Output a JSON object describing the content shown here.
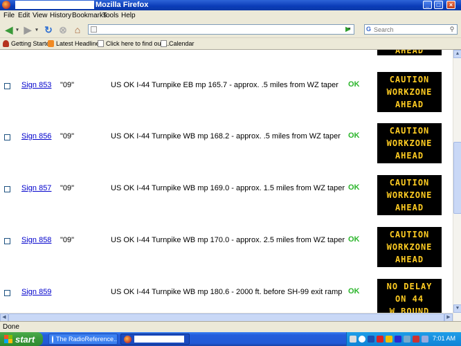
{
  "window": {
    "title": "Mozilla Firefox"
  },
  "menu": [
    "File",
    "Edit",
    "View",
    "History",
    "Bookmarks",
    "Tools",
    "Help"
  ],
  "search": {
    "placeholder": "Search"
  },
  "bookmarks": [
    "Getting Started",
    "Latest Headlines",
    "Click here to find out ...",
    "Calendar"
  ],
  "top_sign_partial": "AHEAD",
  "rows": [
    {
      "sign": "Sign 853",
      "code": "\"09\"",
      "location": "US OK I-44 Turnpike EB mp 165.7 - approx. .5 miles from WZ taper",
      "status": "OK",
      "message": [
        "CAUTION",
        "WORKZONE",
        "AHEAD"
      ]
    },
    {
      "sign": "Sign 856",
      "code": "\"09\"",
      "location": "US OK I-44 Turnpike WB mp 168.2 - approx. .5 miles from WZ taper",
      "status": "OK",
      "message": [
        "CAUTION",
        "WORKZONE",
        "AHEAD"
      ]
    },
    {
      "sign": "Sign 857",
      "code": "\"09\"",
      "location": "US OK I-44 Turnpike WB mp 169.0 - approx. 1.5 miles from WZ taper",
      "status": "OK",
      "message": [
        "CAUTION",
        "WORKZONE",
        "AHEAD"
      ]
    },
    {
      "sign": "Sign 858",
      "code": "\"09\"",
      "location": "US OK I-44 Turnpike WB mp 170.0 - approx. 2.5 miles from WZ taper",
      "status": "OK",
      "message": [
        "CAUTION",
        "WORKZONE",
        "AHEAD"
      ]
    },
    {
      "sign": "Sign 859",
      "code": "",
      "location": "US OK I-44 Turnpike WB mp 180.6 - 2000 ft. before SH-99 exit ramp",
      "status": "OK",
      "message": [
        "NO DELAY",
        "ON 44",
        "W BOUND"
      ]
    }
  ],
  "statusbar": {
    "text": "Done"
  },
  "taskbar": {
    "start": "start",
    "tasks": [
      "The RadioReference...."
    ],
    "clock": "7:01 AM"
  },
  "colors": {
    "status_ok": "#2ab52a",
    "sign_text": "#ffcc22",
    "link": "#0000cc"
  }
}
